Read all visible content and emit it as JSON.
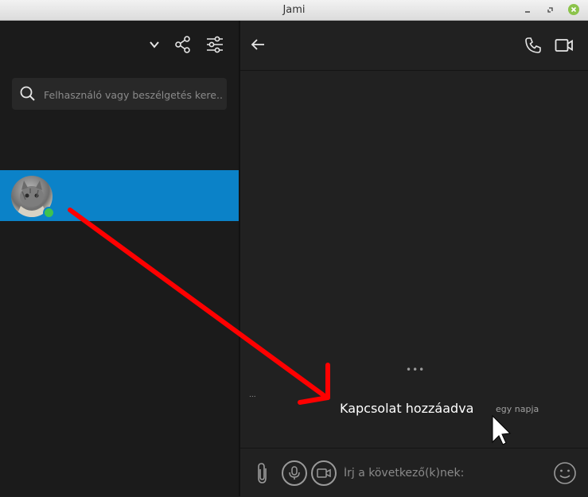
{
  "window": {
    "title": "Jami"
  },
  "sidebar": {
    "search": {
      "placeholder": "Felhasználó vagy beszélgetés kere..."
    },
    "conversation": {
      "avatar": "cat-photo-avatar",
      "status": "online"
    }
  },
  "chat": {
    "typing_indicator": "•••",
    "small_dots": "...",
    "message": {
      "text": "Kapcsolat hozzáadva",
      "time": "egy napja"
    },
    "composer": {
      "placeholder": "Írj a következő(k)nek:"
    }
  },
  "icons": [
    "chevron-down-icon",
    "share-icon",
    "filter-icon",
    "search-icon",
    "back-arrow-icon",
    "phone-icon",
    "video-camera-icon",
    "paperclip-icon",
    "microphone-icon",
    "video-message-icon",
    "emoji-icon"
  ],
  "colors": {
    "accent": "#0b82c8",
    "presence": "#3fc24f",
    "annotation": "#ff0000"
  }
}
